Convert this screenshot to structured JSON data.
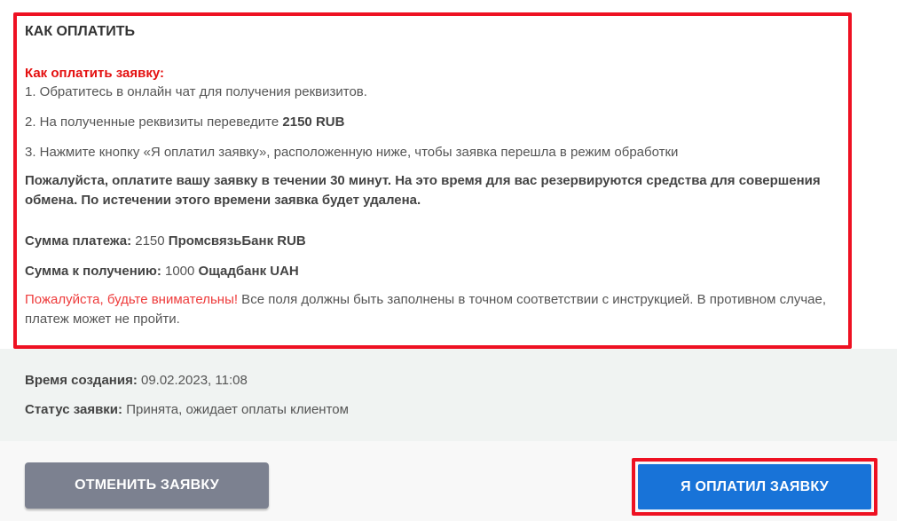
{
  "instructions": {
    "heading": "КАК ОПЛАТИТЬ",
    "sub_heading": "Как оплатить заявку:",
    "step1": "1. Обратитесь в онлайн чат для получения реквизитов.",
    "step2_prefix": "2. На полученные реквизиты переведите ",
    "step2_amount": "2150 RUB",
    "step3": "3. Нажмите кнопку «Я оплатил заявку», расположенную ниже, чтобы заявка перешла в режим обработки",
    "notice": "Пожалуйста, оплатите вашу заявку в течении 30 минут. На это время для вас резервируются средства для совершения обмена. По истечении этого времени заявка будет удалена.",
    "payment_sum": {
      "label": "Сумма платежа:",
      "amount": " 2150 ",
      "currency": "ПромсвязьБанк RUB"
    },
    "receive_sum": {
      "label": "Сумма к получению:",
      "amount": " 1000 ",
      "currency": "Ощадбанк UAH"
    },
    "warning_red": "Пожалуйста, будьте внимательны!",
    "warning_text": " Все поля должны быть заполнены в точном соответствии с инструкцией. В противном случае, платеж может не пройти."
  },
  "meta": {
    "created_label": "Время создания:",
    "created_value": " 09.02.2023, 11:08",
    "status_label": "Статус заявки:",
    "status_value": " Принята, ожидает оплаты клиентом"
  },
  "actions": {
    "cancel_label": "Отменить заявку",
    "paid_label": "Я оплатил заявку"
  },
  "colors": {
    "highlight_border": "#ee1122",
    "primary_button": "#1873d8",
    "secondary_button": "#7c8190",
    "accent_red": "#e41010"
  }
}
